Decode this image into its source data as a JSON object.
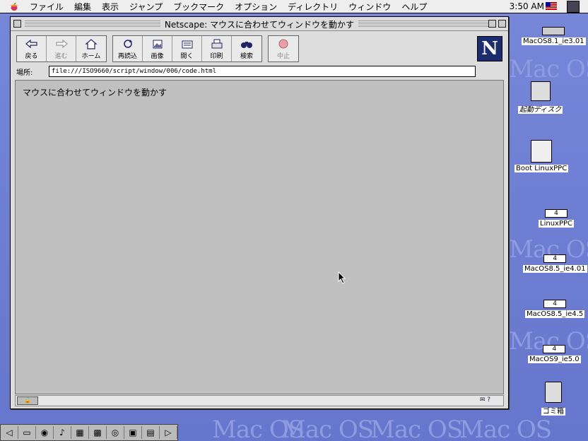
{
  "menubar": {
    "items": [
      "ファイル",
      "編集",
      "表示",
      "ジャンプ",
      "ブックマーク",
      "オプション",
      "ディレクトリ",
      "ウィンドウ",
      "ヘルプ"
    ],
    "clock": "3:50 AM"
  },
  "window": {
    "title": "Netscape: マウスに合わせてウィンドウを動かす",
    "toolbar": {
      "nav": [
        "戻る",
        "進む",
        "ホーム"
      ],
      "actions": [
        "再読込",
        "画像",
        "開く",
        "印刷",
        "検索"
      ],
      "stop": "中止"
    },
    "location": {
      "label": "場所:",
      "url": "file:///ISO9660/script/window/006/code.html"
    },
    "content_text": "マウスに合わせてウィンドウを動かす"
  },
  "desktop": {
    "background_word": "Mac OS",
    "icons": [
      {
        "label": "MacOS8.1_ie3.01"
      },
      {
        "label": "起動ディスク"
      },
      {
        "label": "Boot LinuxPPC"
      },
      {
        "label": "LinuxPPC",
        "drive": "4"
      },
      {
        "label": "MacOS8.5_ie4.01",
        "drive": "4"
      },
      {
        "label": "MacOS8.5_ie4.5",
        "drive": "4"
      },
      {
        "label": "MacOS9_ie5.0",
        "drive": "4"
      },
      {
        "label": "ゴミ箱"
      }
    ]
  },
  "colors": {
    "desktop": "#6f7fd4",
    "window": "#dddddd",
    "content": "#c0c0c0"
  }
}
